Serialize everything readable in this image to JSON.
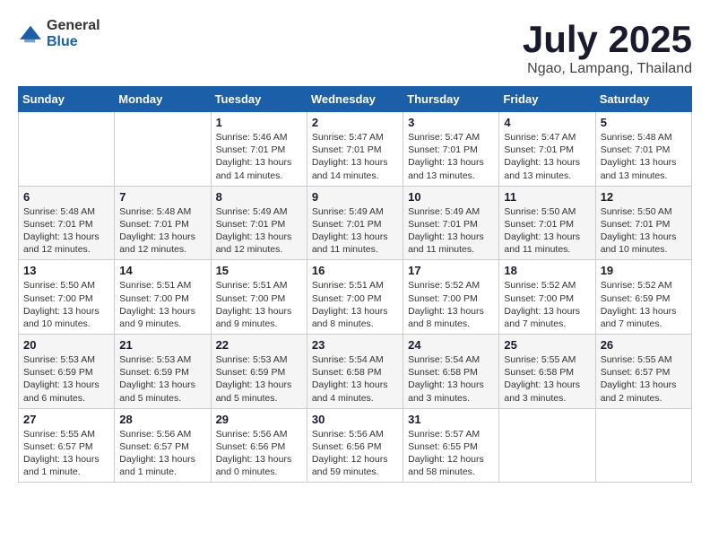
{
  "header": {
    "logo": {
      "general": "General",
      "blue": "Blue"
    },
    "title": "July 2025",
    "location": "Ngao, Lampang, Thailand"
  },
  "calendar": {
    "headers": [
      "Sunday",
      "Monday",
      "Tuesday",
      "Wednesday",
      "Thursday",
      "Friday",
      "Saturday"
    ],
    "weeks": [
      [
        {
          "day": "",
          "content": ""
        },
        {
          "day": "",
          "content": ""
        },
        {
          "day": "1",
          "content": "Sunrise: 5:46 AM\nSunset: 7:01 PM\nDaylight: 13 hours\nand 14 minutes."
        },
        {
          "day": "2",
          "content": "Sunrise: 5:47 AM\nSunset: 7:01 PM\nDaylight: 13 hours\nand 14 minutes."
        },
        {
          "day": "3",
          "content": "Sunrise: 5:47 AM\nSunset: 7:01 PM\nDaylight: 13 hours\nand 13 minutes."
        },
        {
          "day": "4",
          "content": "Sunrise: 5:47 AM\nSunset: 7:01 PM\nDaylight: 13 hours\nand 13 minutes."
        },
        {
          "day": "5",
          "content": "Sunrise: 5:48 AM\nSunset: 7:01 PM\nDaylight: 13 hours\nand 13 minutes."
        }
      ],
      [
        {
          "day": "6",
          "content": "Sunrise: 5:48 AM\nSunset: 7:01 PM\nDaylight: 13 hours\nand 12 minutes."
        },
        {
          "day": "7",
          "content": "Sunrise: 5:48 AM\nSunset: 7:01 PM\nDaylight: 13 hours\nand 12 minutes."
        },
        {
          "day": "8",
          "content": "Sunrise: 5:49 AM\nSunset: 7:01 PM\nDaylight: 13 hours\nand 12 minutes."
        },
        {
          "day": "9",
          "content": "Sunrise: 5:49 AM\nSunset: 7:01 PM\nDaylight: 13 hours\nand 11 minutes."
        },
        {
          "day": "10",
          "content": "Sunrise: 5:49 AM\nSunset: 7:01 PM\nDaylight: 13 hours\nand 11 minutes."
        },
        {
          "day": "11",
          "content": "Sunrise: 5:50 AM\nSunset: 7:01 PM\nDaylight: 13 hours\nand 11 minutes."
        },
        {
          "day": "12",
          "content": "Sunrise: 5:50 AM\nSunset: 7:01 PM\nDaylight: 13 hours\nand 10 minutes."
        }
      ],
      [
        {
          "day": "13",
          "content": "Sunrise: 5:50 AM\nSunset: 7:00 PM\nDaylight: 13 hours\nand 10 minutes."
        },
        {
          "day": "14",
          "content": "Sunrise: 5:51 AM\nSunset: 7:00 PM\nDaylight: 13 hours\nand 9 minutes."
        },
        {
          "day": "15",
          "content": "Sunrise: 5:51 AM\nSunset: 7:00 PM\nDaylight: 13 hours\nand 9 minutes."
        },
        {
          "day": "16",
          "content": "Sunrise: 5:51 AM\nSunset: 7:00 PM\nDaylight: 13 hours\nand 8 minutes."
        },
        {
          "day": "17",
          "content": "Sunrise: 5:52 AM\nSunset: 7:00 PM\nDaylight: 13 hours\nand 8 minutes."
        },
        {
          "day": "18",
          "content": "Sunrise: 5:52 AM\nSunset: 7:00 PM\nDaylight: 13 hours\nand 7 minutes."
        },
        {
          "day": "19",
          "content": "Sunrise: 5:52 AM\nSunset: 6:59 PM\nDaylight: 13 hours\nand 7 minutes."
        }
      ],
      [
        {
          "day": "20",
          "content": "Sunrise: 5:53 AM\nSunset: 6:59 PM\nDaylight: 13 hours\nand 6 minutes."
        },
        {
          "day": "21",
          "content": "Sunrise: 5:53 AM\nSunset: 6:59 PM\nDaylight: 13 hours\nand 5 minutes."
        },
        {
          "day": "22",
          "content": "Sunrise: 5:53 AM\nSunset: 6:59 PM\nDaylight: 13 hours\nand 5 minutes."
        },
        {
          "day": "23",
          "content": "Sunrise: 5:54 AM\nSunset: 6:58 PM\nDaylight: 13 hours\nand 4 minutes."
        },
        {
          "day": "24",
          "content": "Sunrise: 5:54 AM\nSunset: 6:58 PM\nDaylight: 13 hours\nand 3 minutes."
        },
        {
          "day": "25",
          "content": "Sunrise: 5:55 AM\nSunset: 6:58 PM\nDaylight: 13 hours\nand 3 minutes."
        },
        {
          "day": "26",
          "content": "Sunrise: 5:55 AM\nSunset: 6:57 PM\nDaylight: 13 hours\nand 2 minutes."
        }
      ],
      [
        {
          "day": "27",
          "content": "Sunrise: 5:55 AM\nSunset: 6:57 PM\nDaylight: 13 hours\nand 1 minute."
        },
        {
          "day": "28",
          "content": "Sunrise: 5:56 AM\nSunset: 6:57 PM\nDaylight: 13 hours\nand 1 minute."
        },
        {
          "day": "29",
          "content": "Sunrise: 5:56 AM\nSunset: 6:56 PM\nDaylight: 13 hours\nand 0 minutes."
        },
        {
          "day": "30",
          "content": "Sunrise: 5:56 AM\nSunset: 6:56 PM\nDaylight: 12 hours\nand 59 minutes."
        },
        {
          "day": "31",
          "content": "Sunrise: 5:57 AM\nSunset: 6:55 PM\nDaylight: 12 hours\nand 58 minutes."
        },
        {
          "day": "",
          "content": ""
        },
        {
          "day": "",
          "content": ""
        }
      ]
    ]
  }
}
